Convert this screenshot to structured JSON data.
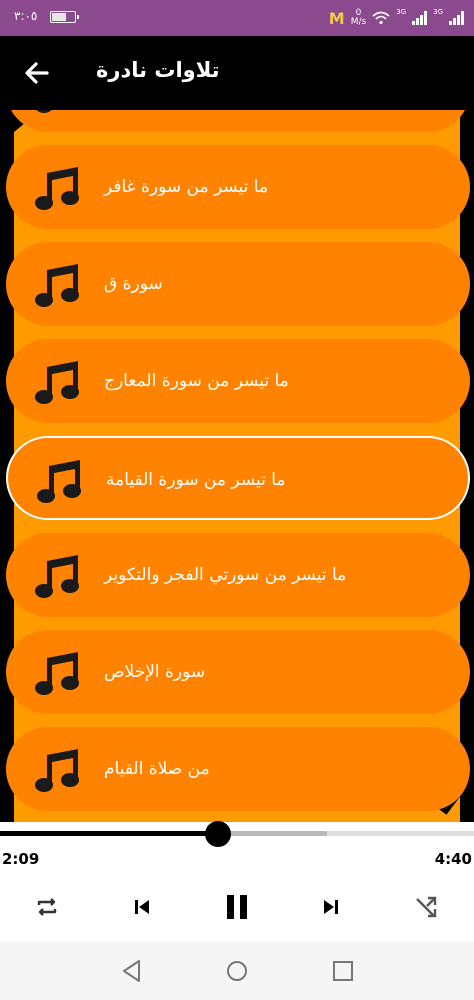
{
  "status_bar": {
    "time": "٣:٠٥",
    "speed_value": "0",
    "speed_unit": "M/s",
    "network_1": "3G",
    "network_2": "3G"
  },
  "app_bar": {
    "title": "تلاوات نادرة",
    "back_icon": "arrow-left-icon"
  },
  "tracks": [
    {
      "label": "",
      "icon": "music-note-icon"
    },
    {
      "label": "ما تيسر من سورة غافر",
      "icon": "music-note-icon"
    },
    {
      "label": "سورة ق",
      "icon": "music-note-icon"
    },
    {
      "label": "ما تيسر من سورة المعارج",
      "icon": "music-note-icon"
    },
    {
      "label": "ما تيسر من سورة القيامة",
      "icon": "music-note-icon",
      "selected": true
    },
    {
      "label": "ما تيسر من سورتي الفجر والتكوير",
      "icon": "music-note-icon"
    },
    {
      "label": "سورة الإخلاص",
      "icon": "music-note-icon"
    },
    {
      "label": "من صلاة القيام",
      "icon": "music-note-icon"
    }
  ],
  "player": {
    "current_time": "2:09",
    "total_time": "4:40",
    "progress": 0.46,
    "buffered": 0.69,
    "controls": [
      "repeat-icon",
      "skip-previous-icon",
      "pause-icon",
      "skip-next-icon",
      "shuffle-icon"
    ]
  },
  "nav_bar": {
    "buttons": [
      "nav-back-icon",
      "nav-home-icon",
      "nav-recents-icon"
    ]
  },
  "colors": {
    "status_bar": "#8b4a8d",
    "app_bar": "#000000",
    "accent_orange": "#ff8200",
    "text_light": "#ffffff",
    "player_dark": "#000000"
  }
}
